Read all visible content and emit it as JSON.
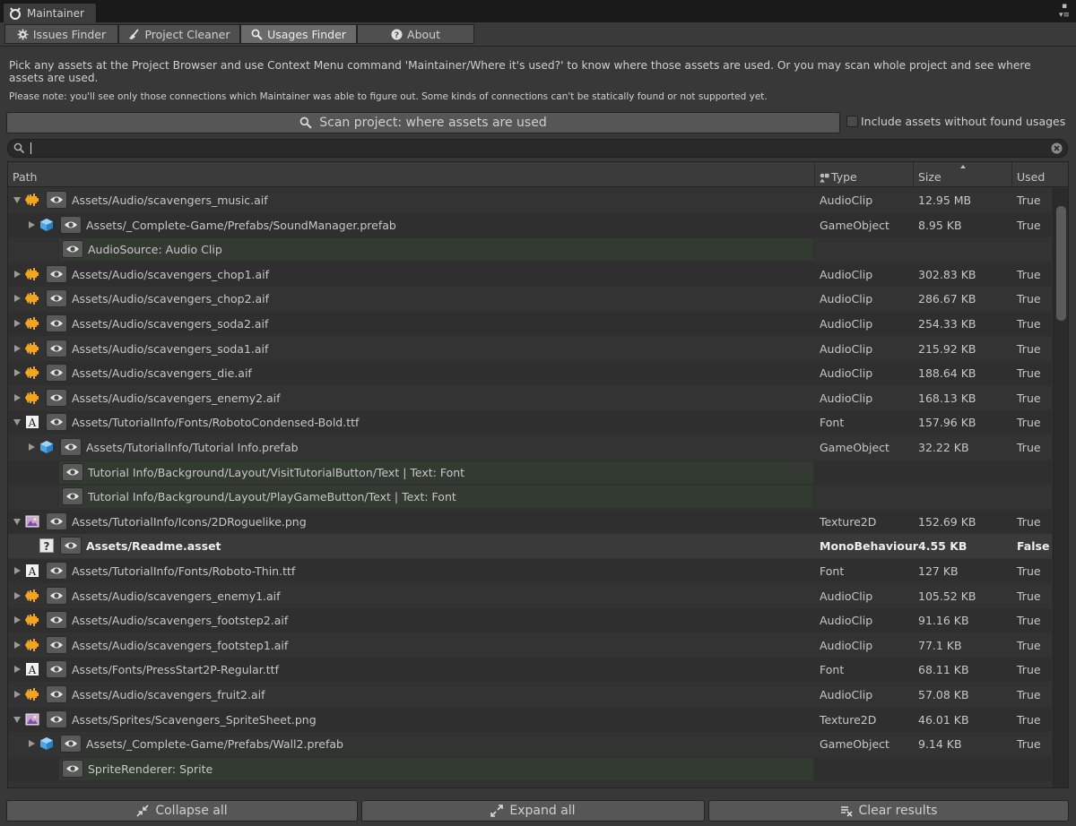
{
  "window": {
    "title": "Maintainer"
  },
  "tabs": [
    {
      "label": "Issues Finder",
      "icon": "gear-icon"
    },
    {
      "label": "Project Cleaner",
      "icon": "broom-icon"
    },
    {
      "label": "Usages Finder",
      "icon": "search-icon"
    },
    {
      "label": "About",
      "icon": "question-icon"
    }
  ],
  "active_tab": "Usages Finder",
  "description": {
    "main": "Pick any assets at the Project Browser and use Context Menu command 'Maintainer/Where it's used?' to know where those assets are used. Or you may scan whole project and see where assets are used.",
    "note": "Please note: you'll see only those connections which Maintainer was able to figure out. Some kinds of connections can't be statically found or not supported yet."
  },
  "scan_button": {
    "label": "Scan project: where assets are used"
  },
  "include_checkbox": {
    "label": "Include assets without found usages",
    "checked": false
  },
  "search": {
    "value": "",
    "placeholder": ""
  },
  "table": {
    "columns": {
      "path": "Path",
      "type": "Type",
      "size": "Size",
      "used": "Used"
    },
    "rows": [
      {
        "path": "Assets/Audio/scavengers_music.aif",
        "type": "AudioClip",
        "size": "12.95 MB",
        "used": "True"
      },
      {
        "path": "Assets/_Complete-Game/Prefabs/SoundManager.prefab",
        "type": "GameObject",
        "size": "8.95 KB",
        "used": "True"
      },
      {
        "path": "AudioSource: Audio Clip",
        "type": "",
        "size": "",
        "used": ""
      },
      {
        "path": "Assets/Audio/scavengers_chop1.aif",
        "type": "AudioClip",
        "size": "302.83 KB",
        "used": "True"
      },
      {
        "path": "Assets/Audio/scavengers_chop2.aif",
        "type": "AudioClip",
        "size": "286.67 KB",
        "used": "True"
      },
      {
        "path": "Assets/Audio/scavengers_soda2.aif",
        "type": "AudioClip",
        "size": "254.33 KB",
        "used": "True"
      },
      {
        "path": "Assets/Audio/scavengers_soda1.aif",
        "type": "AudioClip",
        "size": "215.92 KB",
        "used": "True"
      },
      {
        "path": "Assets/Audio/scavengers_die.aif",
        "type": "AudioClip",
        "size": "188.64 KB",
        "used": "True"
      },
      {
        "path": "Assets/Audio/scavengers_enemy2.aif",
        "type": "AudioClip",
        "size": "168.13 KB",
        "used": "True"
      },
      {
        "path": "Assets/TutorialInfo/Fonts/RobotoCondensed-Bold.ttf",
        "type": "Font",
        "size": "157.96 KB",
        "used": "True"
      },
      {
        "path": "Assets/TutorialInfo/Tutorial Info.prefab",
        "type": "GameObject",
        "size": "32.22 KB",
        "used": "True"
      },
      {
        "path": "Tutorial Info/Background/Layout/VisitTutorialButton/Text | Text: Font",
        "type": "",
        "size": "",
        "used": ""
      },
      {
        "path": "Tutorial Info/Background/Layout/PlayGameButton/Text | Text: Font",
        "type": "",
        "size": "",
        "used": ""
      },
      {
        "path": "Assets/TutorialInfo/Icons/2DRoguelike.png",
        "type": "Texture2D",
        "size": "152.69 KB",
        "used": "True"
      },
      {
        "path": "Assets/Readme.asset",
        "type": "MonoBehaviour",
        "size": "4.55 KB",
        "used": "False"
      },
      {
        "path": "Assets/TutorialInfo/Fonts/Roboto-Thin.ttf",
        "type": "Font",
        "size": "127 KB",
        "used": "True"
      },
      {
        "path": "Assets/Audio/scavengers_enemy1.aif",
        "type": "AudioClip",
        "size": "105.52 KB",
        "used": "True"
      },
      {
        "path": "Assets/Audio/scavengers_footstep2.aif",
        "type": "AudioClip",
        "size": "91.16 KB",
        "used": "True"
      },
      {
        "path": "Assets/Audio/scavengers_footstep1.aif",
        "type": "AudioClip",
        "size": "77.1 KB",
        "used": "True"
      },
      {
        "path": "Assets/Fonts/PressStart2P-Regular.ttf",
        "type": "Font",
        "size": "68.11 KB",
        "used": "True"
      },
      {
        "path": "Assets/Audio/scavengers_fruit2.aif",
        "type": "AudioClip",
        "size": "57.08 KB",
        "used": "True"
      },
      {
        "path": "Assets/Sprites/Scavengers_SpriteSheet.png",
        "type": "Texture2D",
        "size": "46.01 KB",
        "used": "True"
      },
      {
        "path": "Assets/_Complete-Game/Prefabs/Wall2.prefab",
        "type": "GameObject",
        "size": "9.14 KB",
        "used": "True"
      },
      {
        "path": "SpriteRenderer: Sprite",
        "type": "",
        "size": "",
        "used": ""
      }
    ]
  },
  "buttons": {
    "collapse": "Collapse all",
    "expand": "Expand all",
    "clear": "Clear results"
  },
  "icons": {
    "audio": "audio-clip-icon",
    "prefab": "prefab-cube-icon",
    "font": "font-icon",
    "texture": "texture-icon",
    "unknown": "unknown-asset-icon",
    "eye": "eye-icon"
  },
  "colors": {
    "audio_icon": "#f2a51d",
    "prefab_icon": "#4aa6e8",
    "reference_bg": "#323a32"
  }
}
